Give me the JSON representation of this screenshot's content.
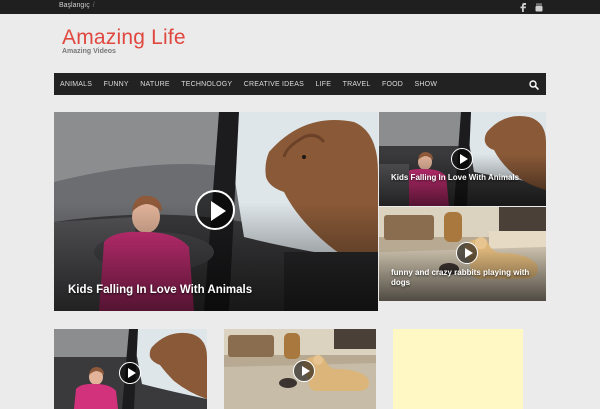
{
  "topbar": {
    "breadcrumb": "Başlangıç",
    "social_icons": [
      "facebook-icon",
      "youtube-icon"
    ]
  },
  "brand": {
    "title": "Amazing Life",
    "tagline": "Amazing Videos",
    "title_color": "#e0473f"
  },
  "nav": {
    "items": [
      "ANIMALS",
      "FUNNY",
      "NATURE",
      "TECHNOLOGY",
      "CREATIVE IDEAS",
      "LIFE",
      "TRAVEL",
      "FOOD",
      "SHOW"
    ],
    "search_icon": "search-icon"
  },
  "featured": {
    "main": {
      "title": "Kids Falling In Love With Animals"
    },
    "side": [
      {
        "title": "Kids Falling In Love With Animals"
      },
      {
        "title": "funny and crazy rabbits playing with dogs"
      }
    ]
  },
  "colors": {
    "topbar": "#1f1f1f",
    "navbar": "#222222",
    "page_bg": "#ebebeb",
    "ad_bg": "#fff7c4"
  }
}
